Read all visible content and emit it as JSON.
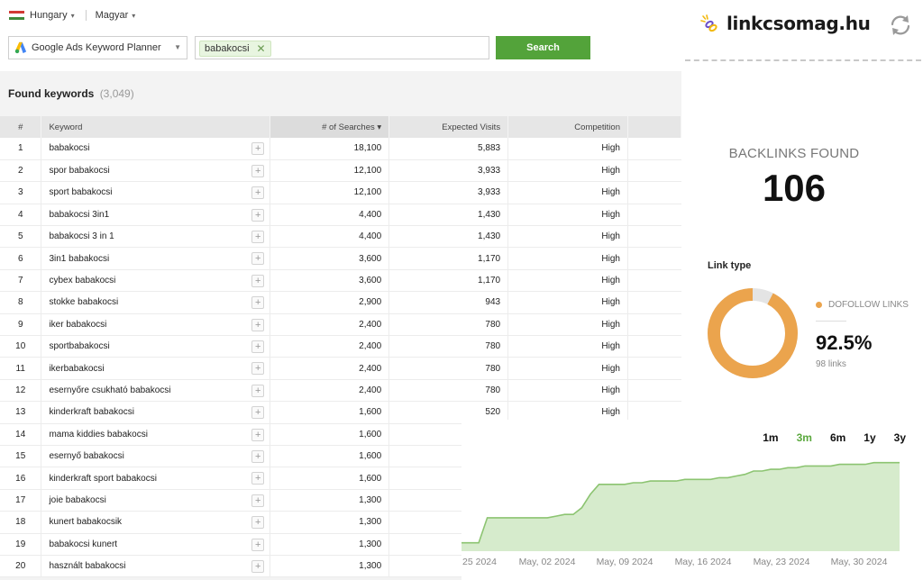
{
  "locale": {
    "country": "Hungary",
    "language": "Magyar"
  },
  "source": {
    "label": "Google Ads Keyword Planner"
  },
  "search": {
    "chip": "babakocsi",
    "button": "Search"
  },
  "found": {
    "label": "Found keywords",
    "count": "(3,049)"
  },
  "table": {
    "headers": {
      "num": "#",
      "keyword": "Keyword",
      "searches": "# of Searches",
      "visits": "Expected Visits",
      "competition": "Competition"
    },
    "rows": [
      {
        "n": "1",
        "kw": "babakocsi",
        "s": "18,100",
        "v": "5,883",
        "c": "High"
      },
      {
        "n": "2",
        "kw": "spor babakocsi",
        "s": "12,100",
        "v": "3,933",
        "c": "High"
      },
      {
        "n": "3",
        "kw": "sport babakocsi",
        "s": "12,100",
        "v": "3,933",
        "c": "High"
      },
      {
        "n": "4",
        "kw": "babakocsi 3in1",
        "s": "4,400",
        "v": "1,430",
        "c": "High"
      },
      {
        "n": "5",
        "kw": "babakocsi 3 in 1",
        "s": "4,400",
        "v": "1,430",
        "c": "High"
      },
      {
        "n": "6",
        "kw": "3in1 babakocsi",
        "s": "3,600",
        "v": "1,170",
        "c": "High"
      },
      {
        "n": "7",
        "kw": "cybex babakocsi",
        "s": "3,600",
        "v": "1,170",
        "c": "High"
      },
      {
        "n": "8",
        "kw": "stokke babakocsi",
        "s": "2,900",
        "v": "943",
        "c": "High"
      },
      {
        "n": "9",
        "kw": "iker babakocsi",
        "s": "2,400",
        "v": "780",
        "c": "High"
      },
      {
        "n": "10",
        "kw": "sportbabakocsi",
        "s": "2,400",
        "v": "780",
        "c": "High"
      },
      {
        "n": "11",
        "kw": "ikerbabakocsi",
        "s": "2,400",
        "v": "780",
        "c": "High"
      },
      {
        "n": "12",
        "kw": "esernyőre csukható babakocsi",
        "s": "2,400",
        "v": "780",
        "c": "High"
      },
      {
        "n": "13",
        "kw": "kinderkraft babakocsi",
        "s": "1,600",
        "v": "520",
        "c": "High"
      },
      {
        "n": "14",
        "kw": "mama kiddies babakocsi",
        "s": "1,600",
        "v": "",
        "c": ""
      },
      {
        "n": "15",
        "kw": "esernyő babakocsi",
        "s": "1,600",
        "v": "",
        "c": ""
      },
      {
        "n": "16",
        "kw": "kinderkraft sport babakocsi",
        "s": "1,600",
        "v": "",
        "c": ""
      },
      {
        "n": "17",
        "kw": "joie babakocsi",
        "s": "1,300",
        "v": "",
        "c": ""
      },
      {
        "n": "18",
        "kw": "kunert babakocsik",
        "s": "1,300",
        "v": "",
        "c": ""
      },
      {
        "n": "19",
        "kw": "babakocsi kunert",
        "s": "1,300",
        "v": "",
        "c": ""
      },
      {
        "n": "20",
        "kw": "használt babakocsi",
        "s": "1,300",
        "v": "",
        "c": ""
      }
    ]
  },
  "card": {
    "brand": "linkcsomag.hu",
    "backlinks_label": "BACKLINKS FOUND",
    "backlinks_value": "106",
    "link_type_label": "Link type",
    "legend_label": "DOFOLLOW LINKS",
    "dofollow_percent": "92.5%",
    "dofollow_fraction": 0.925,
    "links_count": "98 links",
    "colors": {
      "dofollow": "#eba44d",
      "other": "#e4e4e4"
    }
  },
  "chart_panel": {
    "ranges": [
      {
        "label": "1m",
        "active": false
      },
      {
        "label": "3m",
        "active": true
      },
      {
        "label": "6m",
        "active": false
      },
      {
        "label": "1y",
        "active": false
      },
      {
        "label": "3y",
        "active": false
      }
    ]
  },
  "chart_data": {
    "type": "area",
    "title": "",
    "xlabel": "",
    "ylabel": "",
    "x_ticks": [
      "25 2024",
      "May, 02 2024",
      "May, 09 2024",
      "May, 16 2024",
      "May, 23 2024",
      "May, 30 2024"
    ],
    "x": [
      0,
      1,
      2,
      3,
      4,
      5,
      6,
      7,
      8,
      9,
      10,
      11,
      12,
      13,
      14,
      15,
      16,
      17,
      18,
      19,
      20,
      21,
      22,
      23,
      24,
      25,
      26,
      27,
      28,
      29,
      30,
      31,
      32,
      33,
      34,
      35,
      36,
      37,
      38,
      39,
      40,
      41,
      42,
      43,
      44,
      45,
      46,
      47,
      48,
      49,
      50,
      51
    ],
    "values": [
      5,
      5,
      5,
      20,
      20,
      20,
      20,
      20,
      20,
      20,
      20,
      21,
      22,
      22,
      26,
      34,
      40,
      40,
      40,
      40,
      41,
      41,
      42,
      42,
      42,
      42,
      43,
      43,
      43,
      43,
      44,
      44,
      45,
      46,
      48,
      48,
      49,
      49,
      50,
      50,
      51,
      51,
      51,
      51,
      52,
      52,
      52,
      52,
      53,
      53,
      53,
      53
    ],
    "colors": {
      "fill": "#d6ebcc",
      "line": "#8cc471"
    },
    "grid": false
  }
}
